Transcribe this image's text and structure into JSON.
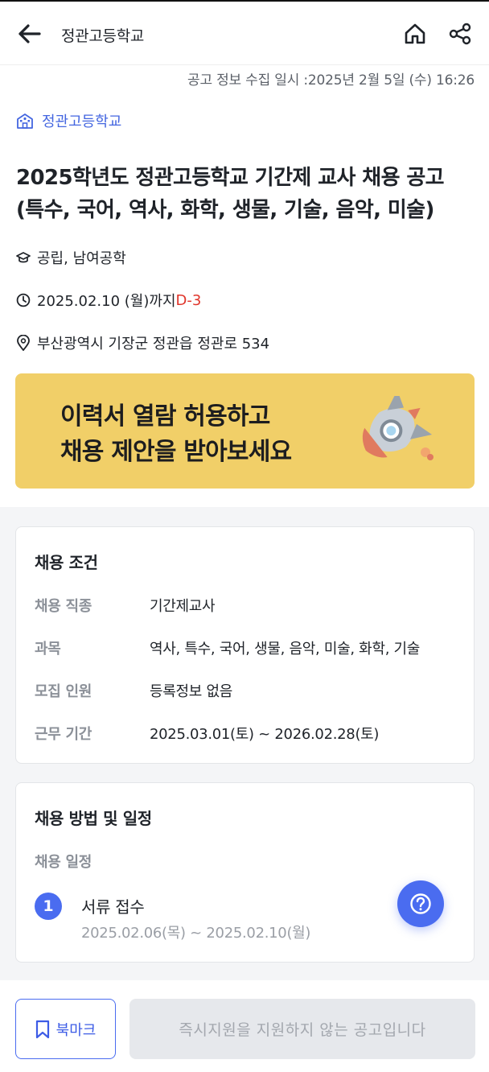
{
  "header": {
    "title": "정관고등학교"
  },
  "posting": {
    "collected_at": "공고 정보 수집 일시 :2025년 2월 5일 (수) 16:26",
    "school_name": "정관고등학교",
    "title_line1": "2025학년도 정관고등학교 기간제 교사 채용 공고",
    "title_line2": "(특수, 국어, 역사, 화학, 생물, 기술, 음악, 미술)",
    "school_type": "공립, 남여공학",
    "deadline": "2025.02.10 (월)까지",
    "dday": "D-3",
    "address": "부산광역시 기장군 정관읍 정관로 534"
  },
  "banner": {
    "line1": "이력서 열람 허용하고",
    "line2": "채용 제안을 받아보세요",
    "colors": {
      "background": "#f1cf68"
    }
  },
  "conditions": {
    "title": "채용 조건",
    "rows": [
      {
        "label": "채용 직종",
        "value": "기간제교사"
      },
      {
        "label": "과목",
        "value": "역사, 특수, 국어, 생물, 음악, 미술, 화학, 기술"
      },
      {
        "label": "모집 인원",
        "value": "등록정보 없음"
      },
      {
        "label": "근무 기간",
        "value": "2025.03.01(토) ~ 2026.02.28(토)"
      }
    ]
  },
  "schedule": {
    "title": "채용 방법 및 일정",
    "subtitle": "채용 일정",
    "steps": [
      {
        "number": "1",
        "name": "서류 접수",
        "period": "2025.02.06(목) ~ 2025.02.10(월)"
      }
    ]
  },
  "bottom": {
    "bookmark_label": "북마크",
    "apply_label": "즉시지원을 지원하지 않는 공고입니다"
  },
  "colors": {
    "accent": "#4a6cf0",
    "dday": "#e0352b",
    "disabled_bg": "#e6e8ec"
  }
}
